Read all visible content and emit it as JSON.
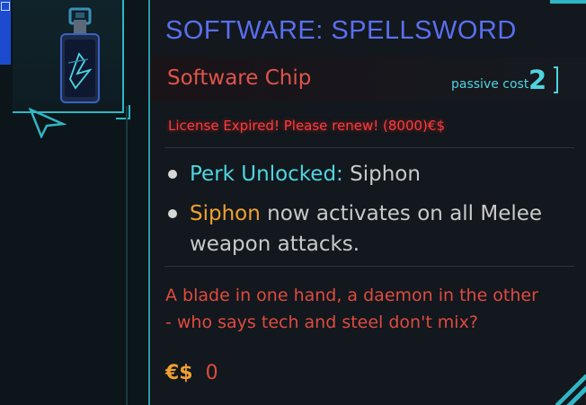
{
  "item": {
    "title": "SOFTWARE: SPELLSWORD",
    "type": "Software Chip",
    "cost_label": "passive cost",
    "cost_value": "2",
    "license_warning": "License Expired! Please renew! (8000)€$",
    "perk": {
      "label": "Perk Unlocked:",
      "value": "Siphon"
    },
    "effect": {
      "keyword": "Siphon",
      "line1_rest": "now activates on all Melee",
      "line2": "weapon attacks."
    },
    "flavor": {
      "line1": "A blade in one hand, a daemon in the other",
      "line2": "- who says tech and steel don't mix?"
    },
    "price": {
      "symbol": "€$",
      "value": "0"
    }
  },
  "colors": {
    "title": "#5a6ff0",
    "accent_cyan": "#4fd5e0",
    "accent_red": "#e04a40",
    "warning_red": "#ff3b3b",
    "keyword_orange": "#f0a030",
    "frame_cyan": "#2fb6c4"
  },
  "icons": [
    "software-chip-icon",
    "cursor-icon",
    "corner-accent-icon"
  ]
}
